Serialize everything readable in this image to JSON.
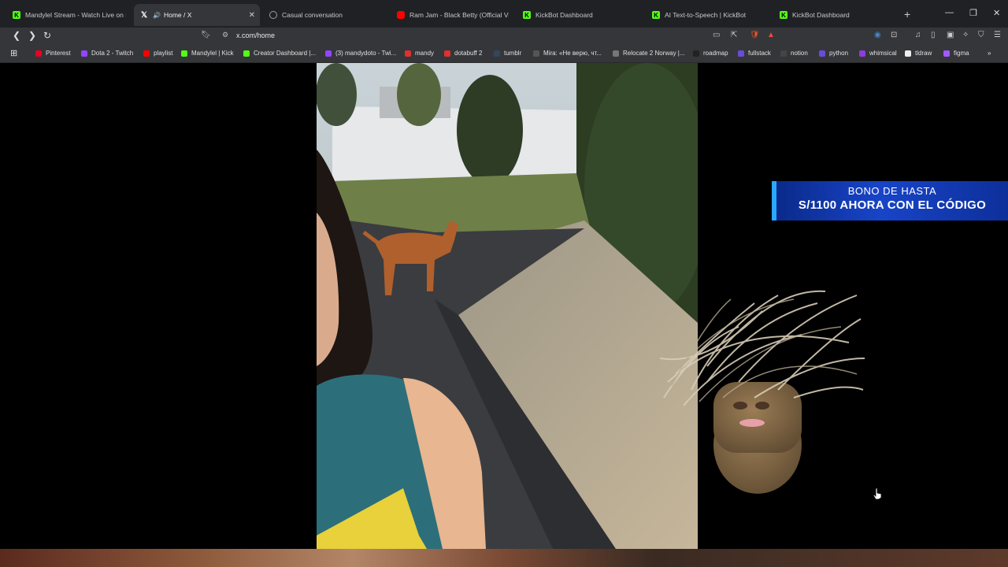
{
  "tabs": [
    {
      "label": "Mandylel Stream - Watch Live on Ki",
      "favicon": "kick-icon",
      "active": false
    },
    {
      "label": "Home / X",
      "favicon": "x-icon",
      "active": true,
      "audio": true
    },
    {
      "label": "Casual conversation",
      "favicon": "globe-icon",
      "active": false
    },
    {
      "label": "Ram Jam - Black Betty (Official Vide",
      "favicon": "youtube-icon",
      "active": false
    },
    {
      "label": "KickBot Dashboard",
      "favicon": "kick-icon",
      "active": false
    },
    {
      "label": "AI Text-to-Speech | KickBot",
      "favicon": "kick-icon",
      "active": false
    },
    {
      "label": "KickBot Dashboard",
      "favicon": "kick-icon",
      "active": false
    }
  ],
  "address_bar": {
    "url": "x.com/home"
  },
  "bookmarks": [
    {
      "label": "Pinterest",
      "color": "#e60023"
    },
    {
      "label": "Dota 2 - Twitch",
      "color": "#9146ff"
    },
    {
      "label": "playlist",
      "color": "#ff0000"
    },
    {
      "label": "Mandylel | Kick",
      "color": "#53fc18"
    },
    {
      "label": "Creator Dashboard |...",
      "color": "#53fc18"
    },
    {
      "label": "(3) mandydoto - Twi...",
      "color": "#9146ff"
    },
    {
      "label": "mandy",
      "color": "#e03030"
    },
    {
      "label": "dotabuff 2",
      "color": "#e03030"
    },
    {
      "label": "tumblr",
      "color": "#35465c"
    },
    {
      "label": "Mira: «Не верю, чт...",
      "color": "#555555"
    },
    {
      "label": "Relocate 2 Norway |...",
      "color": "#777777"
    },
    {
      "label": "roadmap",
      "color": "#222222"
    },
    {
      "label": "fullstack",
      "color": "#6b4bd8"
    },
    {
      "label": "notion",
      "color": "#444444"
    },
    {
      "label": "python",
      "color": "#6b4bd8"
    },
    {
      "label": "whimsical",
      "color": "#8a3fd8"
    },
    {
      "label": "tldraw",
      "color": "#eeeeee"
    },
    {
      "label": "figma",
      "color": "#a259ff"
    }
  ],
  "promo": {
    "line1": "BONO DE HASTA",
    "line2": "S/1100 AHORA CON EL CÓDIGO"
  },
  "colors": {
    "tabstrip": "#202124",
    "toolbar": "#35363a",
    "accent_promo": "#1844c8"
  }
}
